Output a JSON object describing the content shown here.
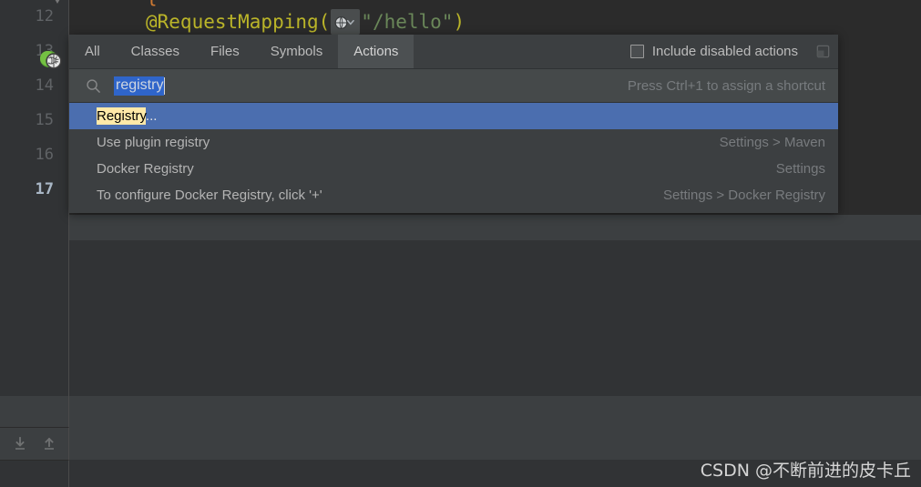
{
  "editor": {
    "gutter_lines": [
      {
        "number": "12",
        "current": false
      },
      {
        "number": "13",
        "current": false
      },
      {
        "number": "14",
        "current": false
      },
      {
        "number": "15",
        "current": false
      },
      {
        "number": "16",
        "current": false
      },
      {
        "number": "17",
        "current": true
      }
    ],
    "gutter_icon_name": "spring-web-mapping-icon",
    "code_line": {
      "annotation": "@RequestMapping(",
      "inline_hint_icon": "globe-icon",
      "inline_hint_chevron": "chevron-down-icon",
      "string_literal": "\"/hello\"",
      "close_paren": ")"
    },
    "top_partial_text": "{",
    "toolbar": {
      "import_icon": "download-arrow-icon",
      "export_icon": "upload-arrow-icon"
    }
  },
  "popup": {
    "tabs": [
      {
        "label": "All",
        "active": false
      },
      {
        "label": "Classes",
        "active": false
      },
      {
        "label": "Files",
        "active": false
      },
      {
        "label": "Symbols",
        "active": false
      },
      {
        "label": "Actions",
        "active": true
      }
    ],
    "include_disabled": {
      "label": "Include disabled actions",
      "checked": false
    },
    "window_icon": "open-in-window-icon",
    "search": {
      "icon": "search-icon",
      "value": "registry",
      "selected": true,
      "hint": "Press Ctrl+1 to assign a shortcut"
    },
    "results": [
      {
        "label": "Registry",
        "match": "Registry",
        "suffix": "...",
        "path": "",
        "selected": true
      },
      {
        "label": "Use plugin registry",
        "match": "",
        "suffix": "",
        "path": "Settings > Maven",
        "selected": false
      },
      {
        "label": "Docker Registry",
        "match": "",
        "suffix": "",
        "path": "Settings",
        "selected": false
      },
      {
        "label": "To configure Docker Registry, click '+'",
        "match": "",
        "suffix": "",
        "path": "Settings > Docker Registry",
        "selected": false
      }
    ]
  },
  "watermark": {
    "text": "CSDN @不断前进的皮卡丘"
  },
  "colors": {
    "accent_selection": "#4b6eaf",
    "match_highlight": "#ffe9a8",
    "annotation_yellow": "#bbb529",
    "string_green": "#6a8759",
    "paren_orange": "#cc7832",
    "editor_bg": "#2b2b2b",
    "panel_bg": "#3c3f41"
  }
}
